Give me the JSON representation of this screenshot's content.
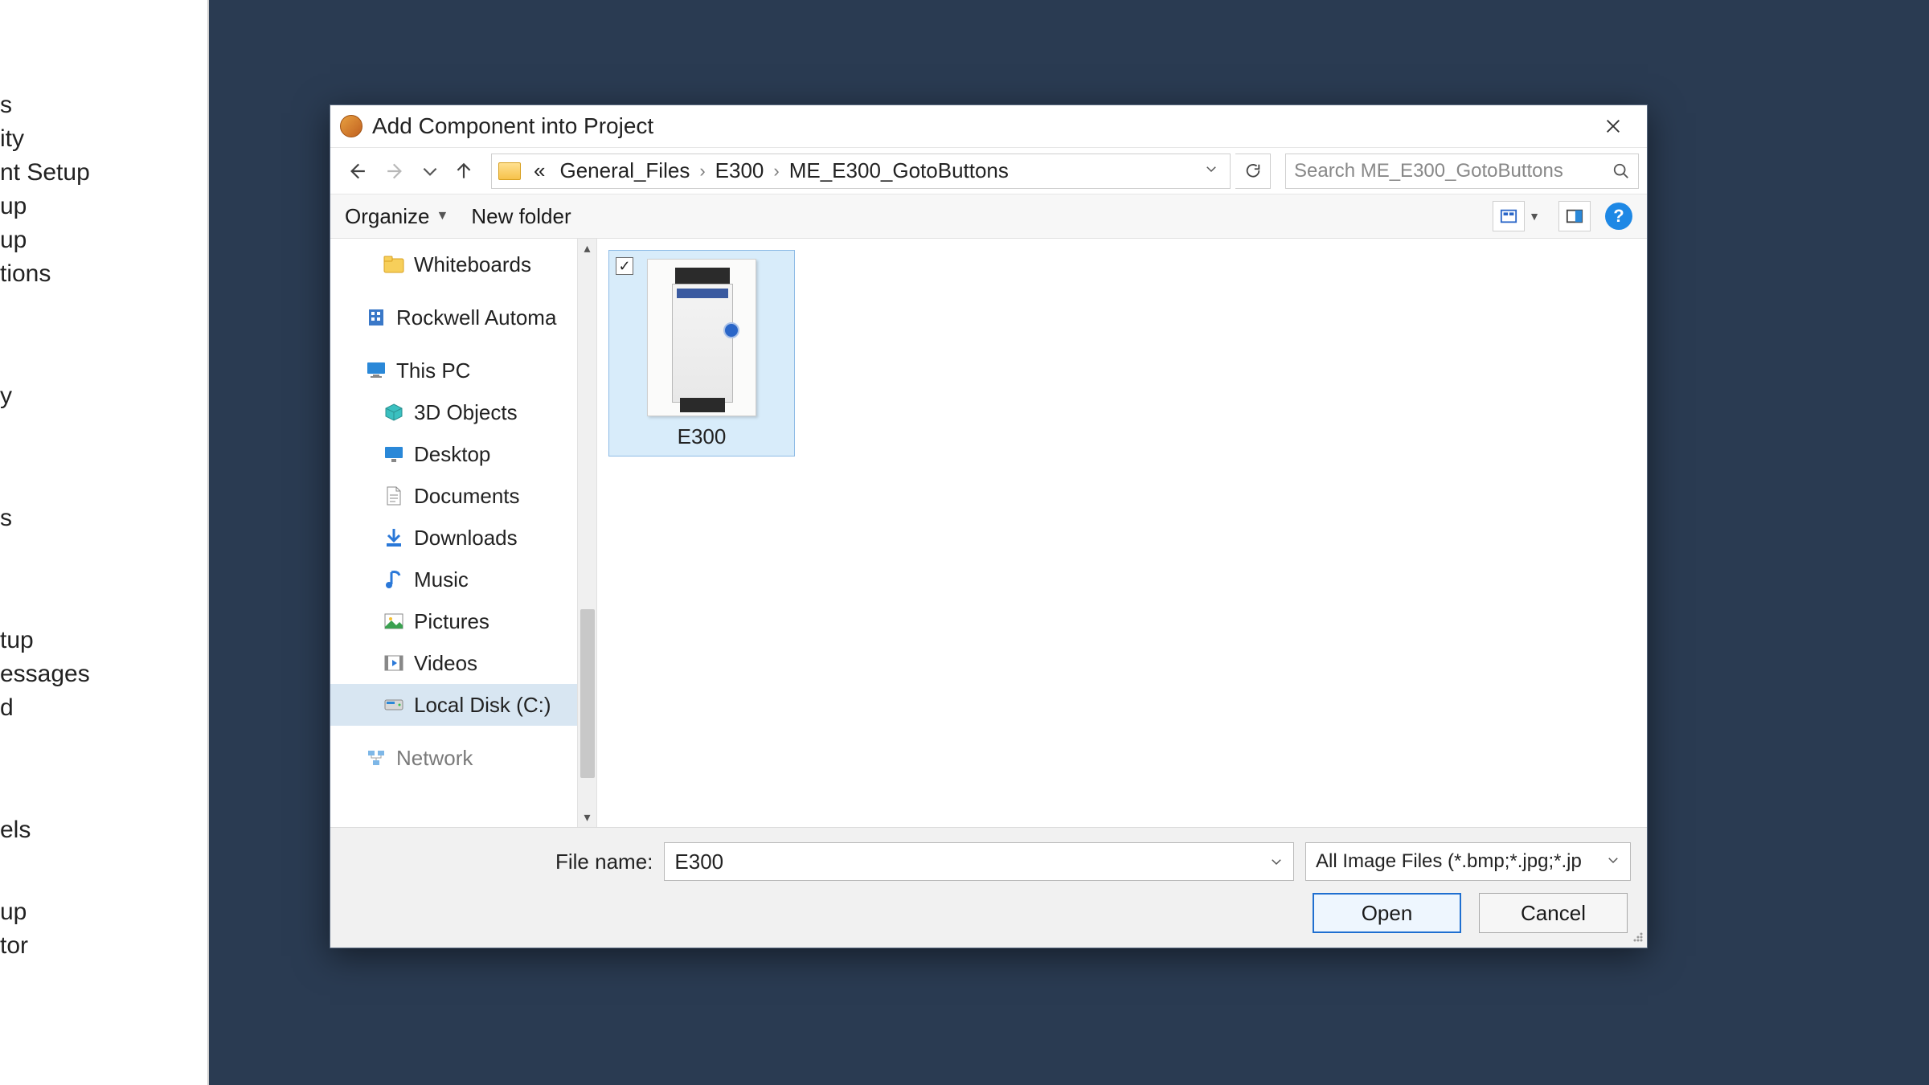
{
  "app_background_items": [
    "s",
    "ity",
    "nt Setup",
    "up",
    "up",
    "tions",
    "",
    "",
    "y",
    "",
    "",
    "s",
    "",
    "",
    "tup",
    "essages",
    "d",
    "",
    "",
    "els",
    "",
    "",
    "up",
    "tor"
  ],
  "dialog": {
    "title": "Add Component into Project",
    "breadcrumb": {
      "prefix": "«",
      "segments": [
        "General_Files",
        "E300",
        "ME_E300_GotoButtons"
      ]
    },
    "search_placeholder": "Search ME_E300_GotoButtons",
    "toolbar": {
      "organize_label": "Organize",
      "newfolder_label": "New folder"
    },
    "tree": [
      {
        "label": "Whiteboards",
        "icon": "folder",
        "level": 2
      },
      {
        "label": "Rockwell Automa",
        "icon": "company",
        "level": 1
      },
      {
        "label": "This PC",
        "icon": "monitor",
        "level": 1
      },
      {
        "label": "3D Objects",
        "icon": "3d",
        "level": 2
      },
      {
        "label": "Desktop",
        "icon": "desktop",
        "level": 2
      },
      {
        "label": "Documents",
        "icon": "doc",
        "level": 2
      },
      {
        "label": "Downloads",
        "icon": "download",
        "level": 2
      },
      {
        "label": "Music",
        "icon": "music",
        "level": 2
      },
      {
        "label": "Pictures",
        "icon": "picture",
        "level": 2
      },
      {
        "label": "Videos",
        "icon": "video",
        "level": 2
      },
      {
        "label": "Local Disk (C:)",
        "icon": "disk",
        "level": 2,
        "selected": true
      },
      {
        "label": "Network",
        "icon": "network",
        "level": 1,
        "cut": true
      }
    ],
    "files": [
      {
        "name": "E300",
        "checked": true
      }
    ],
    "bottom": {
      "filename_label": "File name:",
      "filename_value": "E300",
      "filter_label": "All Image Files (*.bmp;*.jpg;*.jp",
      "open_label": "Open",
      "cancel_label": "Cancel"
    }
  }
}
